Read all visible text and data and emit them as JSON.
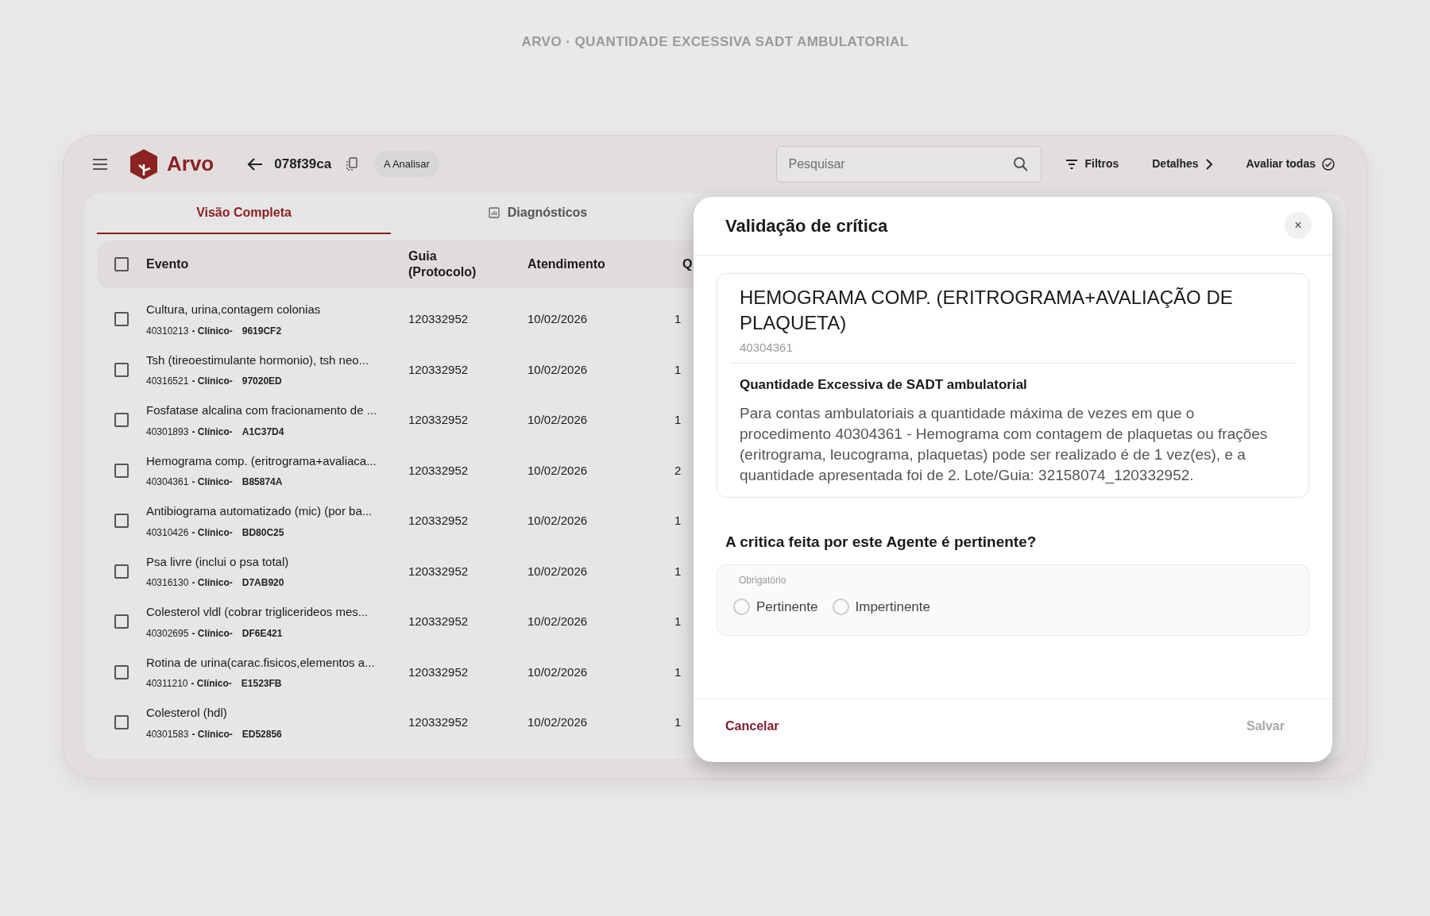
{
  "page_caption": "ARVO · QUANTIDADE EXCESSIVA SADT AMBULATORIAL",
  "header": {
    "brand": "Arvo",
    "record_id": "078f39ca",
    "status_badge": "A Analisar",
    "search": {
      "placeholder": "Pesquisar"
    },
    "actions": [
      {
        "label": "Filtros",
        "kind": "filter"
      },
      {
        "label": "Detalhes",
        "kind": "chevron"
      },
      {
        "label": "Avaliar todas",
        "kind": "check"
      }
    ]
  },
  "tabs": [
    {
      "label": "Visão Completa",
      "selected": true
    },
    {
      "label": "Diagnósticos",
      "selected": false
    }
  ],
  "table": {
    "select_all_checked": false,
    "columns": [
      "Evento",
      "Guia (Protocolo)",
      "Atendimento",
      "Q"
    ],
    "rows": [
      {
        "name": "Cultura, urina,contagem colonias",
        "code": "40310213",
        "tag": "- Clínico-",
        "ref": "9619CF2",
        "guia": "120332952",
        "date": "10/02/2026",
        "qty": "1",
        "checked": false
      },
      {
        "name": "Tsh (tireoestimulante hormonio), tsh neo...",
        "code": "40316521",
        "tag": "- Clínico-",
        "ref": "97020ED",
        "guia": "120332952",
        "date": "10/02/2026",
        "qty": "1",
        "checked": false
      },
      {
        "name": "Fosfatase alcalina com fracionamento de ...",
        "code": "40301893",
        "tag": "- Clínico-",
        "ref": "A1C37D4",
        "guia": "120332952",
        "date": "10/02/2026",
        "qty": "1",
        "checked": false
      },
      {
        "name": "Hemograma comp. (eritrograma+avaliaca...",
        "code": "40304361",
        "tag": "- Clínico-",
        "ref": "B85874A",
        "guia": "120332952",
        "date": "10/02/2026",
        "qty": "2",
        "checked": false
      },
      {
        "name": "Antibiograma automatizado (mic) (por ba...",
        "code": "40310426",
        "tag": "- Clínico-",
        "ref": "BD80C25",
        "guia": "120332952",
        "date": "10/02/2026",
        "qty": "1",
        "checked": false
      },
      {
        "name": "Psa livre (inclui o psa total)",
        "code": "40316130",
        "tag": "- Clínico-",
        "ref": "D7AB920",
        "guia": "120332952",
        "date": "10/02/2026",
        "qty": "1",
        "checked": false
      },
      {
        "name": "Colesterol vldl (cobrar triglicerideos mes...",
        "code": "40302695",
        "tag": "- Clínico-",
        "ref": "DF6E421",
        "guia": "120332952",
        "date": "10/02/2026",
        "qty": "1",
        "checked": false
      },
      {
        "name": "Rotina de urina(carac.fisicos,elementos a...",
        "code": "40311210",
        "tag": "- Clínico-",
        "ref": "E1523FB",
        "guia": "120332952",
        "date": "10/02/2026",
        "qty": "1",
        "checked": false
      },
      {
        "name": "Colesterol (hdl)",
        "code": "40301583",
        "tag": "- Clínico-",
        "ref": "ED52856",
        "guia": "120332952",
        "date": "10/02/2026",
        "qty": "1",
        "checked": false
      }
    ]
  },
  "modal": {
    "title": "Validação de crítica",
    "close": "×",
    "procedure_name": "HEMOGRAMA COMP. (ERITROGRAMA+AVALIAÇÃO DE PLAQUETA)",
    "procedure_code": "40304361",
    "rule_title": "Quantidade Excessiva de SADT ambulatorial",
    "rule_text": "Para contas ambulatoriais a quantidade máxima de vezes em que o procedimento 40304361 - Hemograma com contagem de plaquetas ou frações (eritrograma, leucograma, plaquetas) pode ser realizado é de 1 vez(es), e a quantidade apresentada foi de 2. Lote/Guia: 32158074_120332952.",
    "question": "A critica feita por este Agente é pertinente?",
    "answer_group": {
      "label": "Obrigatório",
      "options": [
        {
          "label": "Pertinente",
          "selected": false
        },
        {
          "label": "Impertinente",
          "selected": false
        }
      ]
    },
    "cancel_button": {
      "label": "Cancelar"
    },
    "save_button": {
      "label": "Salvar",
      "disabled": true
    }
  }
}
